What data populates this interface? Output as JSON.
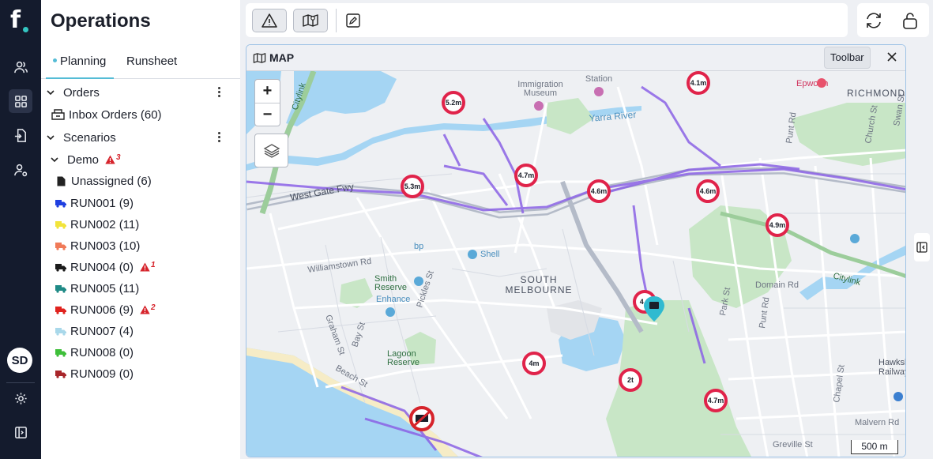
{
  "app": {
    "logo_text": "f",
    "title": "Operations",
    "accent": "#54bcd6",
    "rail_bg": "#141b2d"
  },
  "rail": {
    "items": [
      {
        "icon": "users-icon",
        "active": false
      },
      {
        "icon": "grid-icon",
        "active": true
      },
      {
        "icon": "document-import-icon",
        "active": false
      },
      {
        "icon": "user-settings-icon",
        "active": false
      }
    ],
    "avatar": "SD",
    "bottom": [
      {
        "icon": "gear-icon"
      },
      {
        "icon": "panel-toggle-icon"
      }
    ]
  },
  "tabs": [
    {
      "label": "Planning",
      "active": true
    },
    {
      "label": "Runsheet",
      "active": false
    }
  ],
  "tree": {
    "orders_label": "Orders",
    "inbox_label": "Inbox Orders (60)",
    "scenarios_label": "Scenarios",
    "demo": {
      "label": "Demo",
      "warning": "3"
    },
    "unassigned_label": "Unassigned (6)",
    "runs": [
      {
        "label": "RUN001 (9)",
        "color": "#1f3fe0",
        "warning": ""
      },
      {
        "label": "RUN002 (11)",
        "color": "#f2e43b",
        "warning": ""
      },
      {
        "label": "RUN003 (10)",
        "color": "#f07a58",
        "warning": ""
      },
      {
        "label": "RUN004 (0)",
        "color": "#1b1b1b",
        "warning": "1"
      },
      {
        "label": "RUN005 (11)",
        "color": "#1f8a86",
        "warning": ""
      },
      {
        "label": "RUN006 (9)",
        "color": "#e0231e",
        "warning": "2"
      },
      {
        "label": "RUN007 (4)",
        "color": "#a9d8ea",
        "warning": ""
      },
      {
        "label": "RUN008 (0)",
        "color": "#3fbf3a",
        "warning": ""
      },
      {
        "label": "RUN009 (0)",
        "color": "#a8262a",
        "warning": ""
      }
    ]
  },
  "toolbar": {
    "buttons": [
      "warning-icon",
      "map-icon",
      "edit-icon"
    ],
    "right": [
      "refresh-icon",
      "unlock-icon"
    ]
  },
  "map_panel": {
    "title": "MAP",
    "toolbar_label": "Toolbar",
    "zoom_in": "+",
    "zoom_out": "−",
    "scale": "500 m",
    "labels": {
      "immigration": "Immigration",
      "museum": "Museum",
      "station": "Station",
      "epworth": "Epworth",
      "richmond": "RICHMOND",
      "yarra": "Yarra River",
      "citylink_top": "Citylink",
      "citylink_right": "Citylink",
      "westgate": "West Gate Fwy",
      "williamstown": "Williamstown Rd",
      "smith": "Smith",
      "reserve1": "Reserve",
      "enhance": "Enhance",
      "shell": "Shell",
      "bp": "bp",
      "south": "SOUTH",
      "melbourne": "MELBOURNE",
      "graham": "Graham St",
      "pickles": "Pickles St",
      "bay": "Bay St",
      "beach": "Beach St",
      "lagoon": "Lagoon",
      "reserve2": "Reserve",
      "domain": "Domain Rd",
      "park": "Park St",
      "punt": "Punt Rd",
      "punt2": "Punt Rd",
      "church": "Church St",
      "malvern": "Malvern Rd",
      "greville": "Greville St",
      "chapel": "Chapel St",
      "hawksburn": "Hawksb",
      "railway": "Railway S",
      "swan": "Swan St"
    },
    "height_signs": [
      "5.2m",
      "4.1m",
      "4.7m",
      "5.3m",
      "4.6m",
      "4.6m",
      "4.9m",
      "4.6",
      "4m",
      "2t",
      "4.7m"
    ]
  }
}
